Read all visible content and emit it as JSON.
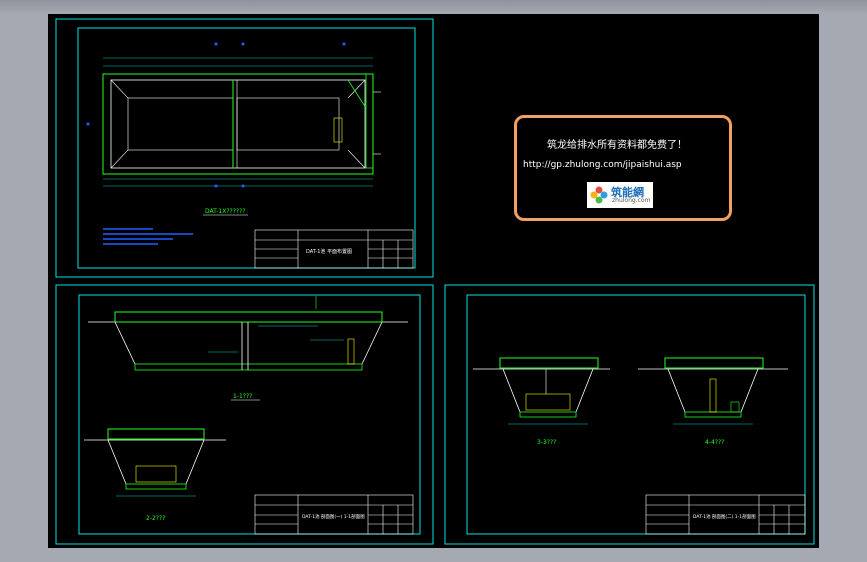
{
  "note": {
    "line1": "筑龙给排水所有资料都免费了！",
    "url": "http://gp.zhulong.com/jipaishui.asp"
  },
  "logo": {
    "name": "筑能網",
    "sub": "zhulong.com"
  },
  "sheets": {
    "top_left": {
      "plan_label": "DAT-1X??????",
      "title_block_name": "DAT-1池 平面布置图"
    },
    "bottom_left": {
      "section1_label": "1-1???",
      "section2_label": "2-2???",
      "title_block_name": "DAT-1池 剖面图(一) 1-1剖面图"
    },
    "right": {
      "section3_label": "3-3???",
      "section4_label": "4-4???",
      "title_block_name": "DAT-1池 剖面图(二) 1-1剖面图"
    }
  },
  "colors": {
    "frame": "#00e0e0",
    "structure": "#20ff20",
    "wall": "#ffffff",
    "dim": "#00c8c8",
    "accent": "#ffff00",
    "note_border": "#f0a060"
  }
}
